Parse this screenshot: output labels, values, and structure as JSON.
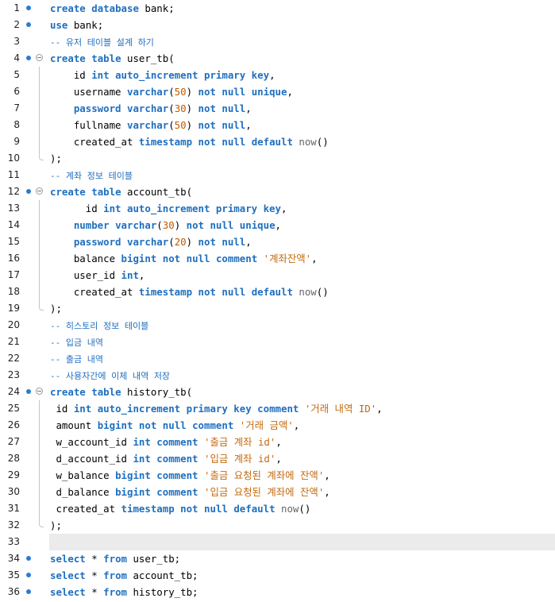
{
  "editor": {
    "lines": [
      {
        "n": "1",
        "bp": true,
        "fold": "",
        "cur": false,
        "tokens": [
          [
            "kw",
            "create"
          ],
          [
            "pl",
            " "
          ],
          [
            "kw",
            "database"
          ],
          [
            "pl",
            " bank;"
          ]
        ]
      },
      {
        "n": "2",
        "bp": true,
        "fold": "",
        "cur": false,
        "tokens": [
          [
            "kw",
            "use"
          ],
          [
            "pl",
            " bank;"
          ]
        ]
      },
      {
        "n": "3",
        "bp": false,
        "fold": "",
        "cur": false,
        "tokens": [
          [
            "cm",
            "-- 유저 테이블 설계 하기"
          ]
        ]
      },
      {
        "n": "4",
        "bp": true,
        "fold": "open",
        "cur": false,
        "tokens": [
          [
            "kw",
            "create"
          ],
          [
            "pl",
            " "
          ],
          [
            "kw",
            "table"
          ],
          [
            "pl",
            " user_tb("
          ]
        ]
      },
      {
        "n": "5",
        "bp": false,
        "fold": "mid",
        "cur": false,
        "tokens": [
          [
            "pl",
            "    id "
          ],
          [
            "kw",
            "int"
          ],
          [
            "pl",
            " "
          ],
          [
            "kw",
            "auto_increment"
          ],
          [
            "pl",
            " "
          ],
          [
            "kw",
            "primary"
          ],
          [
            "pl",
            " "
          ],
          [
            "kw",
            "key"
          ],
          [
            "pl",
            ","
          ]
        ]
      },
      {
        "n": "6",
        "bp": false,
        "fold": "mid",
        "cur": false,
        "tokens": [
          [
            "pl",
            "    username "
          ],
          [
            "kw",
            "varchar"
          ],
          [
            "pl",
            "("
          ],
          [
            "num",
            "50"
          ],
          [
            "pl",
            ") "
          ],
          [
            "kw",
            "not"
          ],
          [
            "pl",
            " "
          ],
          [
            "kw",
            "null"
          ],
          [
            "pl",
            " "
          ],
          [
            "kw",
            "unique"
          ],
          [
            "pl",
            ","
          ]
        ]
      },
      {
        "n": "7",
        "bp": false,
        "fold": "mid",
        "cur": false,
        "tokens": [
          [
            "pl",
            "    "
          ],
          [
            "kw",
            "password"
          ],
          [
            "pl",
            " "
          ],
          [
            "kw",
            "varchar"
          ],
          [
            "pl",
            "("
          ],
          [
            "num",
            "30"
          ],
          [
            "pl",
            ") "
          ],
          [
            "kw",
            "not"
          ],
          [
            "pl",
            " "
          ],
          [
            "kw",
            "null"
          ],
          [
            "pl",
            ","
          ]
        ]
      },
      {
        "n": "8",
        "bp": false,
        "fold": "mid",
        "cur": false,
        "tokens": [
          [
            "pl",
            "    fullname "
          ],
          [
            "kw",
            "varchar"
          ],
          [
            "pl",
            "("
          ],
          [
            "num",
            "50"
          ],
          [
            "pl",
            ") "
          ],
          [
            "kw",
            "not"
          ],
          [
            "pl",
            " "
          ],
          [
            "kw",
            "null"
          ],
          [
            "pl",
            ","
          ]
        ]
      },
      {
        "n": "9",
        "bp": false,
        "fold": "mid",
        "cur": false,
        "tokens": [
          [
            "pl",
            "    created_at "
          ],
          [
            "kw",
            "timestamp"
          ],
          [
            "pl",
            " "
          ],
          [
            "kw",
            "not"
          ],
          [
            "pl",
            " "
          ],
          [
            "kw",
            "null"
          ],
          [
            "pl",
            " "
          ],
          [
            "kw",
            "default"
          ],
          [
            "pl",
            " "
          ],
          [
            "fn",
            "now"
          ],
          [
            "pl",
            "()"
          ]
        ]
      },
      {
        "n": "10",
        "bp": false,
        "fold": "end",
        "cur": false,
        "tokens": [
          [
            "pl",
            ");"
          ]
        ]
      },
      {
        "n": "11",
        "bp": false,
        "fold": "",
        "cur": false,
        "tokens": [
          [
            "cm",
            "-- 계좌 정보 테이블"
          ]
        ]
      },
      {
        "n": "12",
        "bp": true,
        "fold": "open",
        "cur": false,
        "tokens": [
          [
            "kw",
            "create"
          ],
          [
            "pl",
            " "
          ],
          [
            "kw",
            "table"
          ],
          [
            "pl",
            " account_tb("
          ]
        ]
      },
      {
        "n": "13",
        "bp": false,
        "fold": "mid",
        "cur": false,
        "tokens": [
          [
            "pl",
            "      id "
          ],
          [
            "kw",
            "int"
          ],
          [
            "pl",
            " "
          ],
          [
            "kw",
            "auto_increment"
          ],
          [
            "pl",
            " "
          ],
          [
            "kw",
            "primary"
          ],
          [
            "pl",
            " "
          ],
          [
            "kw",
            "key"
          ],
          [
            "pl",
            ","
          ]
        ]
      },
      {
        "n": "14",
        "bp": false,
        "fold": "mid",
        "cur": false,
        "tokens": [
          [
            "pl",
            "    "
          ],
          [
            "kw",
            "number"
          ],
          [
            "pl",
            " "
          ],
          [
            "kw",
            "varchar"
          ],
          [
            "pl",
            "("
          ],
          [
            "num",
            "30"
          ],
          [
            "pl",
            ") "
          ],
          [
            "kw",
            "not"
          ],
          [
            "pl",
            " "
          ],
          [
            "kw",
            "null"
          ],
          [
            "pl",
            " "
          ],
          [
            "kw",
            "unique"
          ],
          [
            "pl",
            ","
          ]
        ]
      },
      {
        "n": "15",
        "bp": false,
        "fold": "mid",
        "cur": false,
        "tokens": [
          [
            "pl",
            "    "
          ],
          [
            "kw",
            "password"
          ],
          [
            "pl",
            " "
          ],
          [
            "kw",
            "varchar"
          ],
          [
            "pl",
            "("
          ],
          [
            "num",
            "20"
          ],
          [
            "pl",
            ") "
          ],
          [
            "kw",
            "not"
          ],
          [
            "pl",
            " "
          ],
          [
            "kw",
            "null"
          ],
          [
            "pl",
            ","
          ]
        ]
      },
      {
        "n": "16",
        "bp": false,
        "fold": "mid",
        "cur": false,
        "tokens": [
          [
            "pl",
            "    balance "
          ],
          [
            "kw",
            "bigint"
          ],
          [
            "pl",
            " "
          ],
          [
            "kw",
            "not"
          ],
          [
            "pl",
            " "
          ],
          [
            "kw",
            "null"
          ],
          [
            "pl",
            " "
          ],
          [
            "kw",
            "comment"
          ],
          [
            "pl",
            " "
          ],
          [
            "str",
            "'계좌잔액'"
          ],
          [
            "pl",
            ","
          ]
        ]
      },
      {
        "n": "17",
        "bp": false,
        "fold": "mid",
        "cur": false,
        "tokens": [
          [
            "pl",
            "    user_id "
          ],
          [
            "kw",
            "int"
          ],
          [
            "pl",
            ","
          ]
        ]
      },
      {
        "n": "18",
        "bp": false,
        "fold": "mid",
        "cur": false,
        "tokens": [
          [
            "pl",
            "    created_at "
          ],
          [
            "kw",
            "timestamp"
          ],
          [
            "pl",
            " "
          ],
          [
            "kw",
            "not"
          ],
          [
            "pl",
            " "
          ],
          [
            "kw",
            "null"
          ],
          [
            "pl",
            " "
          ],
          [
            "kw",
            "default"
          ],
          [
            "pl",
            " "
          ],
          [
            "fn",
            "now"
          ],
          [
            "pl",
            "()"
          ]
        ]
      },
      {
        "n": "19",
        "bp": false,
        "fold": "end",
        "cur": false,
        "tokens": [
          [
            "pl",
            ");"
          ]
        ]
      },
      {
        "n": "20",
        "bp": false,
        "fold": "",
        "cur": false,
        "tokens": [
          [
            "cm",
            "-- 히스토리 정보 테이블"
          ]
        ]
      },
      {
        "n": "21",
        "bp": false,
        "fold": "",
        "cur": false,
        "tokens": [
          [
            "cm",
            "-- 입금 내역"
          ]
        ]
      },
      {
        "n": "22",
        "bp": false,
        "fold": "",
        "cur": false,
        "tokens": [
          [
            "cm",
            "-- 출금 내역"
          ]
        ]
      },
      {
        "n": "23",
        "bp": false,
        "fold": "",
        "cur": false,
        "tokens": [
          [
            "cm",
            "-- 사용자간에 이체 내역 저장"
          ]
        ]
      },
      {
        "n": "24",
        "bp": true,
        "fold": "open",
        "cur": false,
        "tokens": [
          [
            "kw",
            "create"
          ],
          [
            "pl",
            " "
          ],
          [
            "kw",
            "table"
          ],
          [
            "pl",
            " history_tb("
          ]
        ]
      },
      {
        "n": "25",
        "bp": false,
        "fold": "mid",
        "cur": false,
        "tokens": [
          [
            "pl",
            " id "
          ],
          [
            "kw",
            "int"
          ],
          [
            "pl",
            " "
          ],
          [
            "kw",
            "auto_increment"
          ],
          [
            "pl",
            " "
          ],
          [
            "kw",
            "primary"
          ],
          [
            "pl",
            " "
          ],
          [
            "kw",
            "key"
          ],
          [
            "pl",
            " "
          ],
          [
            "kw",
            "comment"
          ],
          [
            "pl",
            " "
          ],
          [
            "str",
            "'거래 내역 ID'"
          ],
          [
            "pl",
            ","
          ]
        ]
      },
      {
        "n": "26",
        "bp": false,
        "fold": "mid",
        "cur": false,
        "tokens": [
          [
            "pl",
            " amount "
          ],
          [
            "kw",
            "bigint"
          ],
          [
            "pl",
            " "
          ],
          [
            "kw",
            "not"
          ],
          [
            "pl",
            " "
          ],
          [
            "kw",
            "null"
          ],
          [
            "pl",
            " "
          ],
          [
            "kw",
            "comment"
          ],
          [
            "pl",
            " "
          ],
          [
            "str",
            "'거래 금액'"
          ],
          [
            "pl",
            ","
          ]
        ]
      },
      {
        "n": "27",
        "bp": false,
        "fold": "mid",
        "cur": false,
        "tokens": [
          [
            "pl",
            " w_account_id "
          ],
          [
            "kw",
            "int"
          ],
          [
            "pl",
            " "
          ],
          [
            "kw",
            "comment"
          ],
          [
            "pl",
            " "
          ],
          [
            "str",
            "'출금 계좌 id'"
          ],
          [
            "pl",
            ","
          ]
        ]
      },
      {
        "n": "28",
        "bp": false,
        "fold": "mid",
        "cur": false,
        "tokens": [
          [
            "pl",
            " d_account_id "
          ],
          [
            "kw",
            "int"
          ],
          [
            "pl",
            " "
          ],
          [
            "kw",
            "comment"
          ],
          [
            "pl",
            " "
          ],
          [
            "str",
            "'입금 계좌 id'"
          ],
          [
            "pl",
            ","
          ]
        ]
      },
      {
        "n": "29",
        "bp": false,
        "fold": "mid",
        "cur": false,
        "tokens": [
          [
            "pl",
            " w_balance "
          ],
          [
            "kw",
            "bigint"
          ],
          [
            "pl",
            " "
          ],
          [
            "kw",
            "comment"
          ],
          [
            "pl",
            " "
          ],
          [
            "str",
            "'출금 요청된 계좌에 잔액'"
          ],
          [
            "pl",
            ","
          ]
        ]
      },
      {
        "n": "30",
        "bp": false,
        "fold": "mid",
        "cur": false,
        "tokens": [
          [
            "pl",
            " d_balance "
          ],
          [
            "kw",
            "bigint"
          ],
          [
            "pl",
            " "
          ],
          [
            "kw",
            "comment"
          ],
          [
            "pl",
            " "
          ],
          [
            "str",
            "'입금 요청된 계좌에 잔액'"
          ],
          [
            "pl",
            ","
          ]
        ]
      },
      {
        "n": "31",
        "bp": false,
        "fold": "mid",
        "cur": false,
        "tokens": [
          [
            "pl",
            " created_at "
          ],
          [
            "kw",
            "timestamp"
          ],
          [
            "pl",
            " "
          ],
          [
            "kw",
            "not"
          ],
          [
            "pl",
            " "
          ],
          [
            "kw",
            "null"
          ],
          [
            "pl",
            " "
          ],
          [
            "kw",
            "default"
          ],
          [
            "pl",
            " "
          ],
          [
            "fn",
            "now"
          ],
          [
            "pl",
            "()"
          ]
        ]
      },
      {
        "n": "32",
        "bp": false,
        "fold": "end",
        "cur": false,
        "tokens": [
          [
            "pl",
            ");"
          ]
        ]
      },
      {
        "n": "33",
        "bp": false,
        "fold": "",
        "cur": true,
        "tokens": []
      },
      {
        "n": "34",
        "bp": true,
        "fold": "",
        "cur": false,
        "tokens": [
          [
            "kw",
            "select"
          ],
          [
            "pl",
            " * "
          ],
          [
            "kw",
            "from"
          ],
          [
            "pl",
            " user_tb;"
          ]
        ]
      },
      {
        "n": "35",
        "bp": true,
        "fold": "",
        "cur": false,
        "tokens": [
          [
            "kw",
            "select"
          ],
          [
            "pl",
            " * "
          ],
          [
            "kw",
            "from"
          ],
          [
            "pl",
            " account_tb;"
          ]
        ]
      },
      {
        "n": "36",
        "bp": true,
        "fold": "",
        "cur": false,
        "tokens": [
          [
            "kw",
            "select"
          ],
          [
            "pl",
            " * "
          ],
          [
            "kw",
            "from"
          ],
          [
            "pl",
            " history_tb;"
          ]
        ]
      }
    ],
    "colors": {
      "keyword": "#1f6fbf",
      "number": "#c05a00",
      "string": "#c46a0e",
      "function": "#666666",
      "breakpoint": "#2b7bd0",
      "current_line": "#ebebeb"
    }
  }
}
